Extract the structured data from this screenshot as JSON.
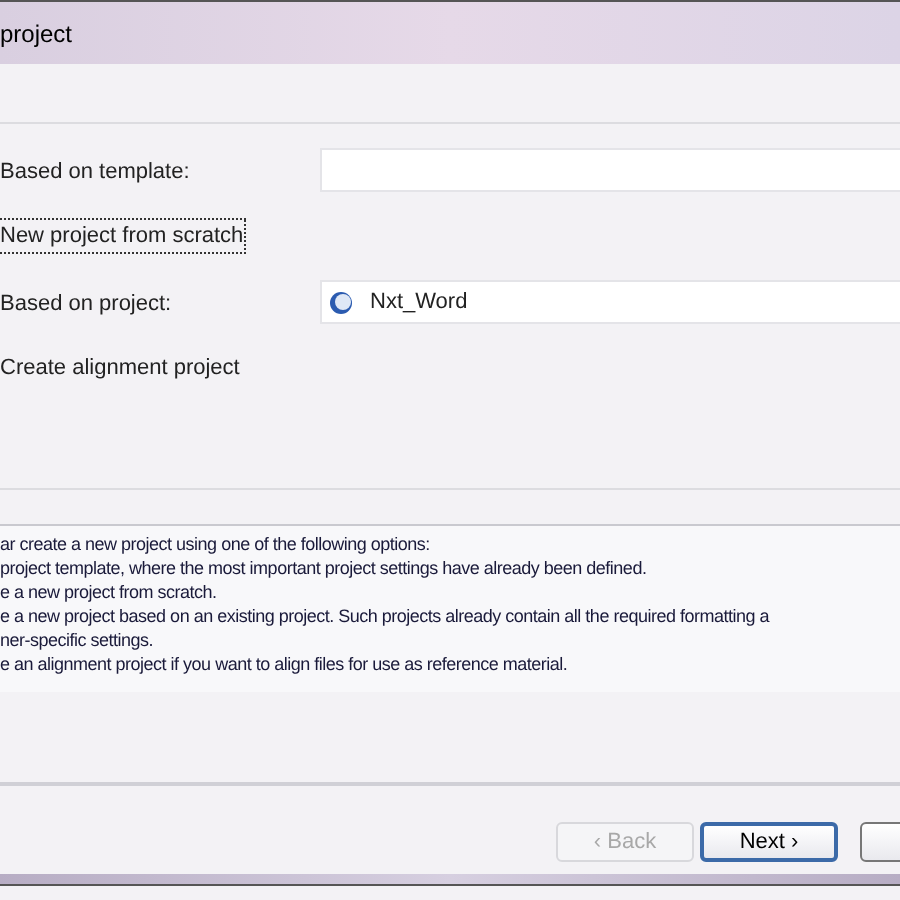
{
  "window": {
    "title": "project"
  },
  "options": [
    {
      "kind": "field-row",
      "label": "Based on template:",
      "focused": false
    },
    {
      "kind": "plain",
      "label": "New project from scratch",
      "focused": true
    },
    {
      "kind": "field-row",
      "label": "Based on project:",
      "focused": false,
      "field": {
        "value": "Nxt_Word"
      }
    },
    {
      "kind": "plain",
      "label": "Create alignment project",
      "focused": false
    }
  ],
  "description": [
    "ar create a new project using one of the following options:",
    "project template, where the most important project settings have already been defined.",
    "e a new project from scratch.",
    "e a new project based on an existing project. Such projects already contain all the required formatting a",
    "ner-specific settings.",
    "e an alignment project if you want to align files for use as reference material."
  ],
  "buttons": [
    {
      "label": "‹ Back",
      "disabled": true,
      "default": false
    },
    {
      "label": "Next ›",
      "disabled": false,
      "default": true
    },
    {
      "disabled": false,
      "default": false
    }
  ]
}
